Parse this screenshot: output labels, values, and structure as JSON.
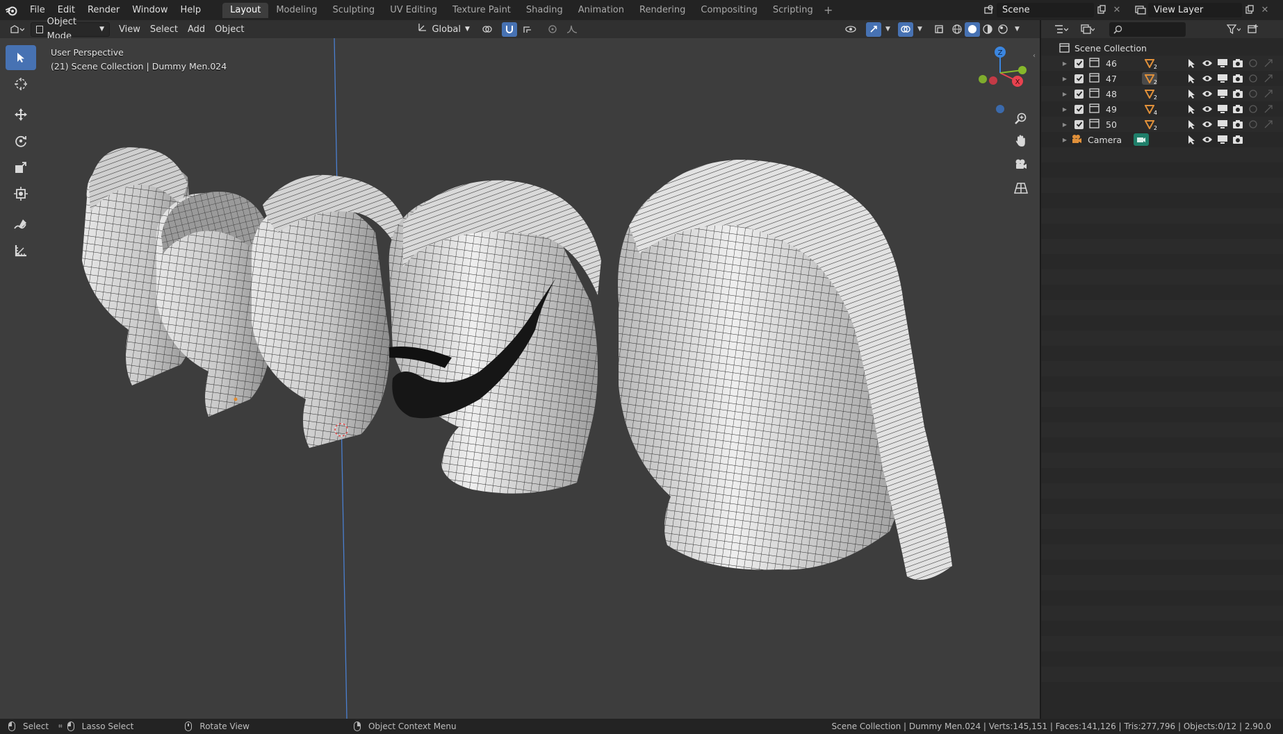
{
  "menu": {
    "items": [
      "File",
      "Edit",
      "Render",
      "Window",
      "Help"
    ]
  },
  "workspaces": {
    "tabs": [
      "Layout",
      "Modeling",
      "Sculpting",
      "UV Editing",
      "Texture Paint",
      "Shading",
      "Animation",
      "Rendering",
      "Compositing",
      "Scripting"
    ],
    "active": "Layout"
  },
  "scene": {
    "name": "Scene"
  },
  "view_layer": {
    "name": "View Layer"
  },
  "viewport_header": {
    "mode": "Object Mode",
    "menus": [
      "View",
      "Select",
      "Add",
      "Object"
    ],
    "orientation": "Global"
  },
  "viewport": {
    "perspective_label": "User Perspective",
    "context_label": "(21) Scene Collection | Dummy Men.024"
  },
  "gizmo": {
    "z_label": "Z",
    "y_label": "Y",
    "x_label": "X"
  },
  "outliner": {
    "search_placeholder": "",
    "root": "Scene Collection",
    "items": [
      {
        "name": "46",
        "type": "collection",
        "badge": "2"
      },
      {
        "name": "47",
        "type": "collection",
        "badge": "2"
      },
      {
        "name": "48",
        "type": "collection",
        "badge": "2"
      },
      {
        "name": "49",
        "type": "collection",
        "badge": "4"
      },
      {
        "name": "50",
        "type": "collection",
        "badge": "2"
      },
      {
        "name": "Camera",
        "type": "camera",
        "badge": ""
      }
    ]
  },
  "statusbar": {
    "select": "Select",
    "lasso": "Lasso Select",
    "rotate": "Rotate View",
    "context_menu": "Object Context Menu",
    "stats": "Scene Collection | Dummy Men.024 | Verts:145,151 | Faces:141,126 | Tris:277,796 | Objects:0/12 | 2.90.0"
  },
  "colors": {
    "accent": "#4772b3",
    "axis_x": "#e8424f",
    "axis_y": "#86b82b",
    "axis_z": "#3b86e0",
    "collection_icon": "#d9d9d9",
    "mesh_orange": "#e0903a",
    "camera_green": "#1f7f6a"
  }
}
